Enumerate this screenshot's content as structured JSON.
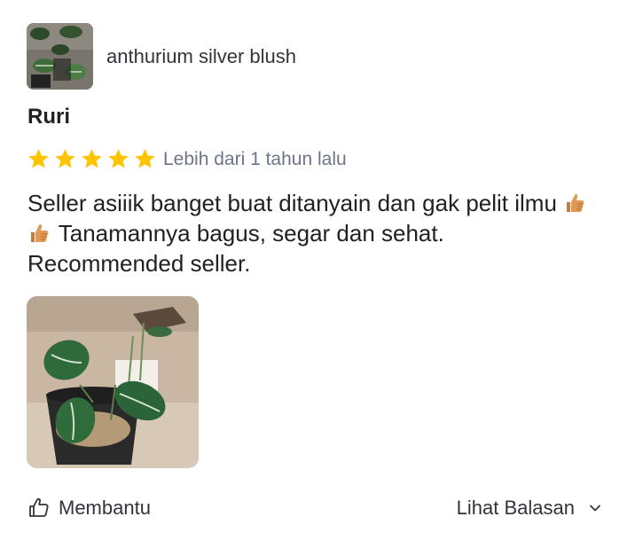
{
  "product": {
    "name": "anthurium silver blush",
    "thumbnail_icon": "plant-thumbnail"
  },
  "review": {
    "reviewer": "Ruri",
    "rating": 5,
    "rating_max": 5,
    "star_color": "#ffc400",
    "time": "Lebih dari 1 tahun lalu",
    "text_part1": "Seller asiiik banget buat ditanyain dan gak pelit ilmu ",
    "text_emojis": [
      "thumbs-up-emoji",
      "thumbs-up-emoji"
    ],
    "text_part2": " Tanamannya bagus, segar dan sehat. Recommended seller.",
    "photo_icon": "plant-photo"
  },
  "footer": {
    "helpful_label": "Membantu",
    "helpful_icon": "thumbs-up-outline-icon",
    "replies_label": "Lihat Balasan",
    "replies_icon": "chevron-down-icon"
  }
}
